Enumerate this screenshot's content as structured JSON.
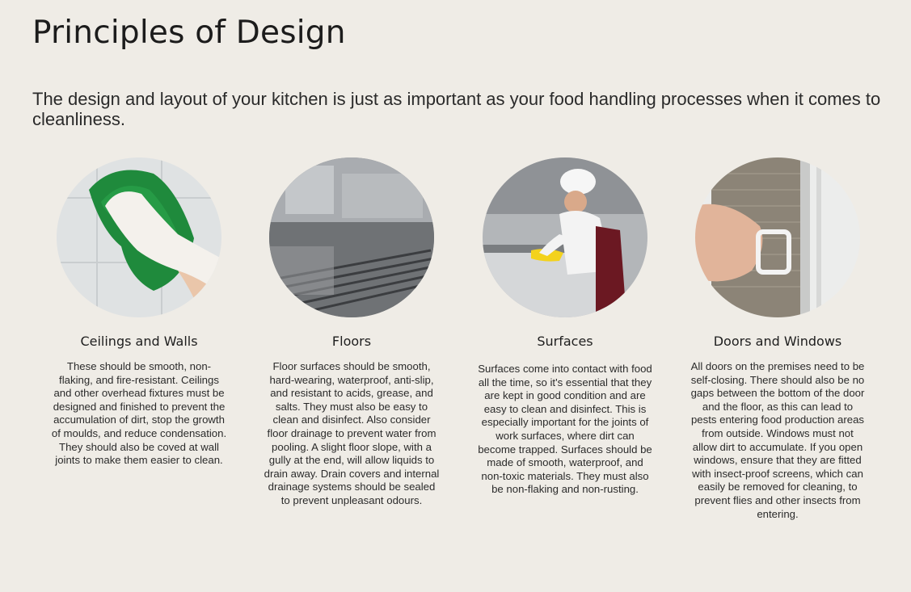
{
  "page": {
    "title": "Principles of Design",
    "intro": "The design and layout of your kitchen is just as important as your food handling processes when it comes to cleanliness."
  },
  "principles": [
    {
      "heading": "Ceilings and Walls",
      "image": "gloved-hand-wiping-tiles",
      "text": "These should be smooth, non-flaking, and fire-resistant. Ceilings and other overhead fixtures must be designed and finished to prevent the accumulation of dirt, stop the growth of moulds, and reduce condensation. They should also be coved at wall joints to make them easier to clean."
    },
    {
      "heading": "Floors",
      "image": "kitchen-floor-drain",
      "text": "Floor surfaces should be smooth, hard-wearing, waterproof, anti-slip, and resistant to acids, grease, and salts. They must also be easy to clean and disinfect. Also consider floor drainage to prevent water from pooling. A slight floor slope, with a gully at the end, will allow liquids to drain away. Drain covers and internal drainage systems should be sealed to prevent unpleasant odours."
    },
    {
      "heading": "Surfaces",
      "image": "chef-cleaning-surface",
      "text": "Surfaces come into contact with food all the time, so it's essential that they are kept in good condition and are easy to clean and disinfect. This is especially important for the joints of work surfaces, where dirt can become trapped. Surfaces should be made of smooth, waterproof, and non-toxic materials. They must also be non-flaking and non-rusting."
    },
    {
      "heading": "Doors and Windows",
      "image": "hand-sliding-insect-screen",
      "text": "All doors on the premises need to be self-closing. There should also be no gaps between the bottom of the door and the floor, as this can lead to pests entering food production areas from outside. Windows must not allow dirt to accumulate. If you open windows, ensure that they are fitted with insect-proof screens, which can easily be removed for cleaning, to prevent flies and other insects from entering."
    }
  ],
  "colors": {
    "background": "#efece6",
    "text": "#222222"
  }
}
